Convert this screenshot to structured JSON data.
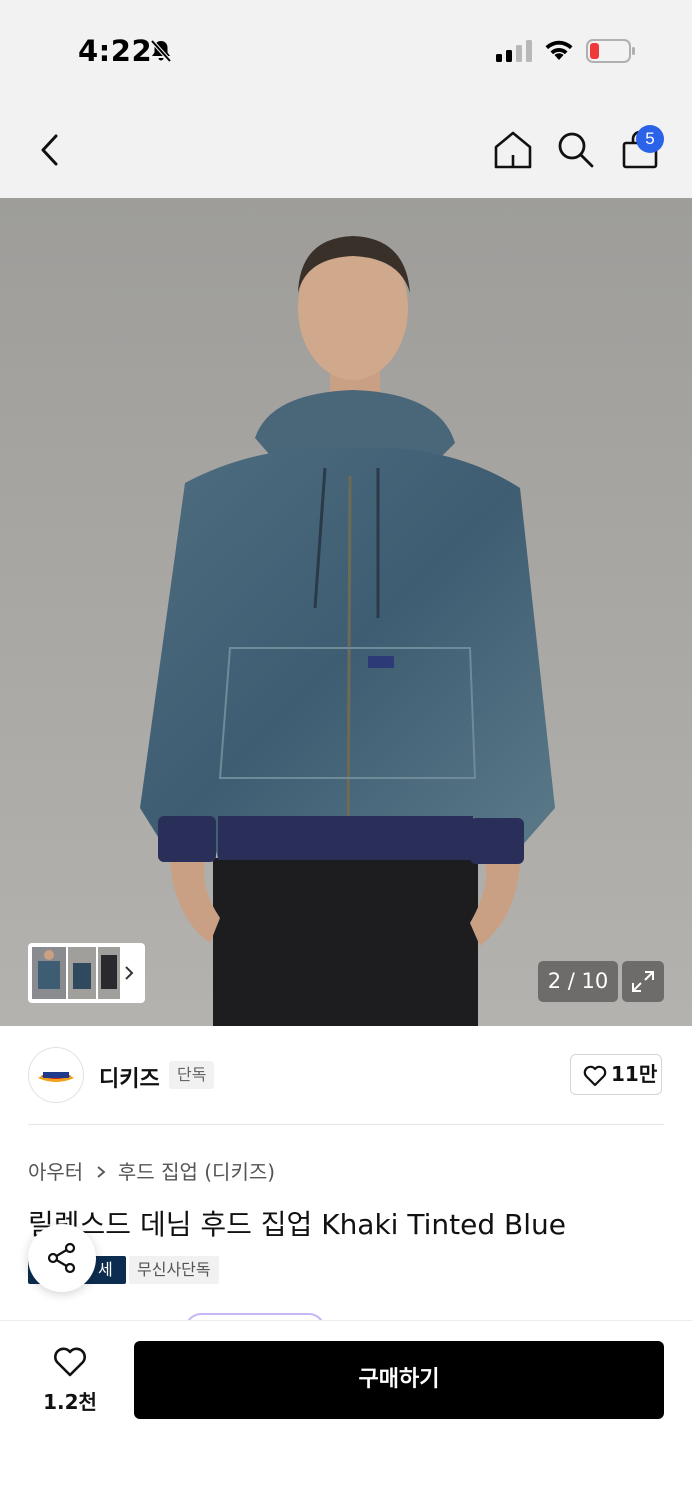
{
  "status_bar": {
    "time": "4:22"
  },
  "nav": {
    "cart_count": "5"
  },
  "gallery": {
    "counter": "2 / 10"
  },
  "brand": {
    "name": "디키즈",
    "tag": "단독",
    "likes": "11만"
  },
  "breadcrumb": {
    "category": "아우터",
    "subcategory": "후드 집업 (디키즈)"
  },
  "product": {
    "title": "릴렉스드 데님 후드 집업 Khaki Tinted Blue",
    "tags": [
      "세이",
      "무신사단독"
    ]
  },
  "bottom": {
    "fav_count": "1.2천",
    "buy_label": "구매하기"
  },
  "colors": {
    "accent_blue": "#2a62e8",
    "dark_tag": "#0c2d4f"
  }
}
